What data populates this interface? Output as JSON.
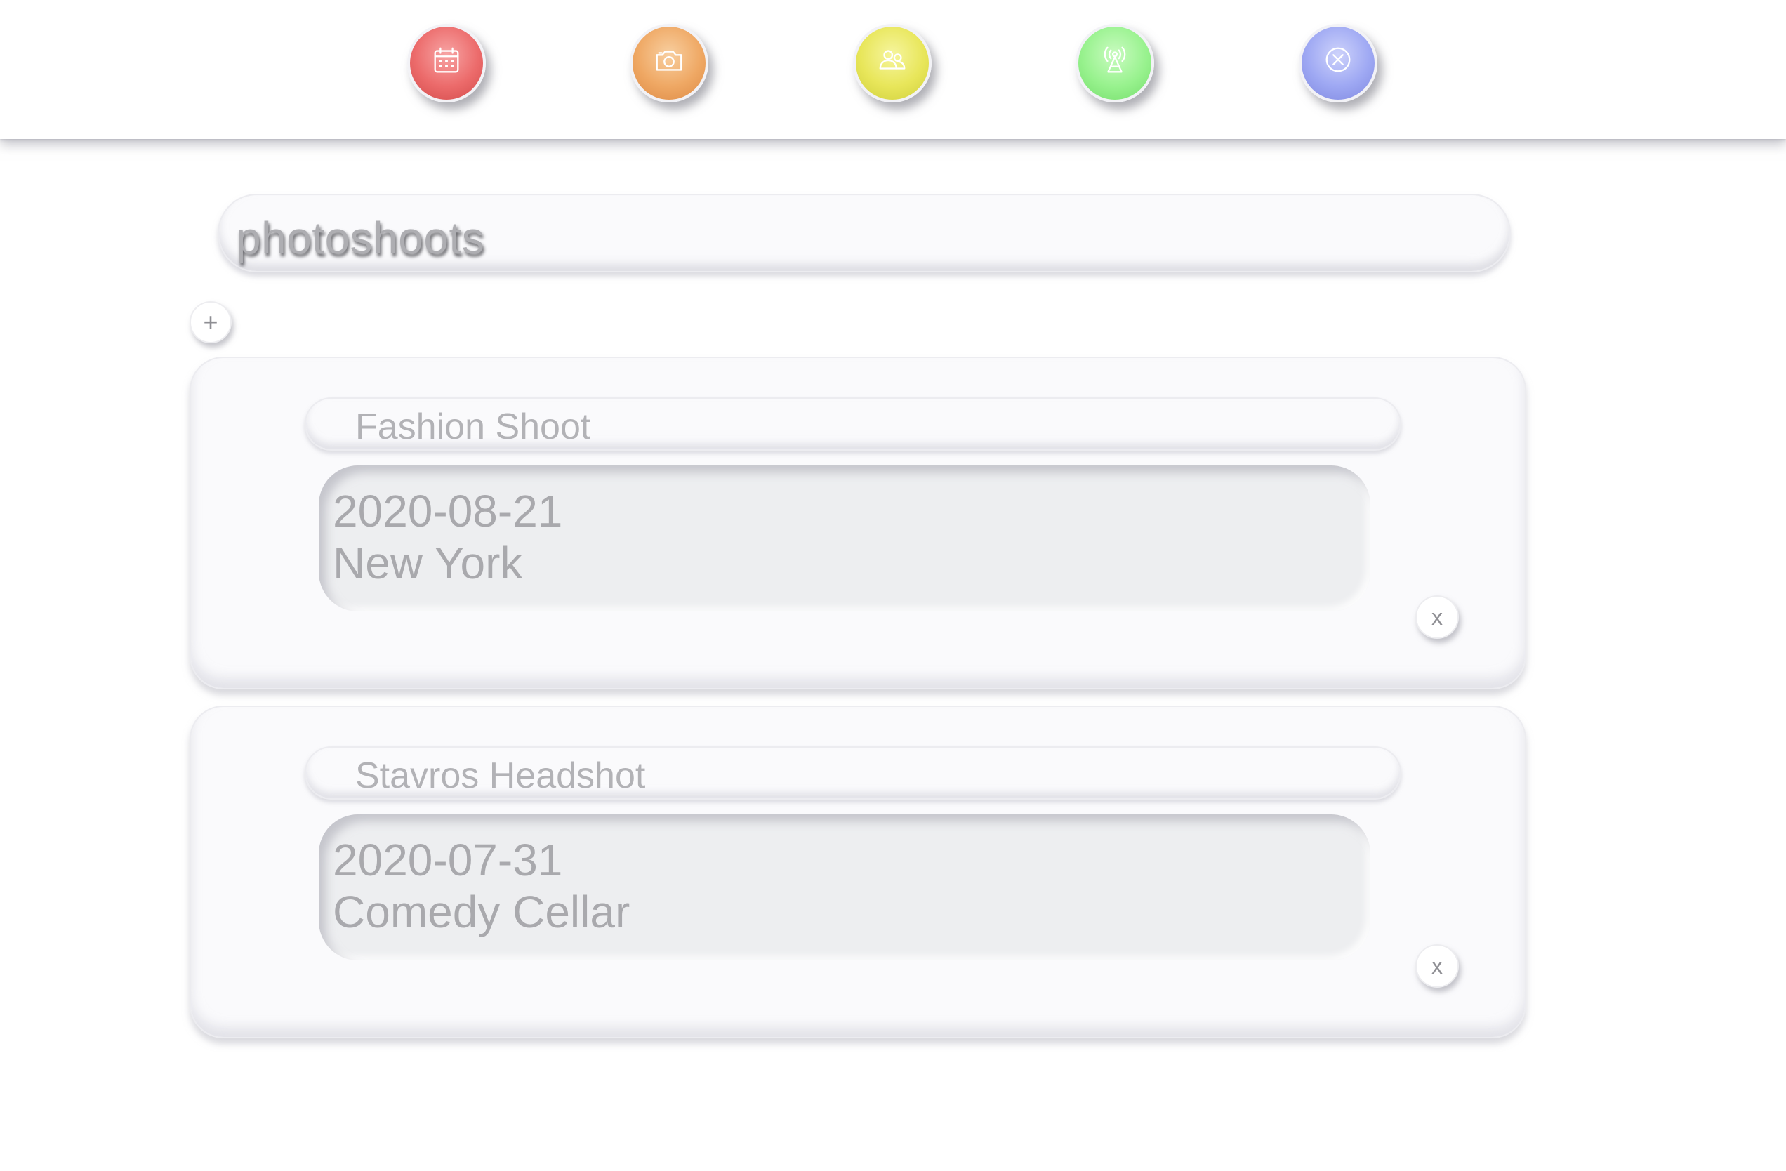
{
  "nav": {
    "items": [
      {
        "icon": "calendar-icon",
        "color": "#ec6b6b"
      },
      {
        "icon": "camera-icon",
        "color": "#efa864"
      },
      {
        "icon": "users-icon",
        "color": "#e8e65a"
      },
      {
        "icon": "broadcast-tower-icon",
        "color": "#98f28e"
      },
      {
        "icon": "close-circle-icon",
        "color": "#9ea8f3"
      }
    ]
  },
  "page": {
    "title": "photoshoots",
    "add_label": "+"
  },
  "shoots": [
    {
      "name": "Fashion Shoot",
      "date": "2020-08-21",
      "location": "New York",
      "remove_label": "x"
    },
    {
      "name": "Stavros Headshot",
      "date": "2020-07-31",
      "location": "Comedy Cellar",
      "remove_label": "x"
    }
  ]
}
